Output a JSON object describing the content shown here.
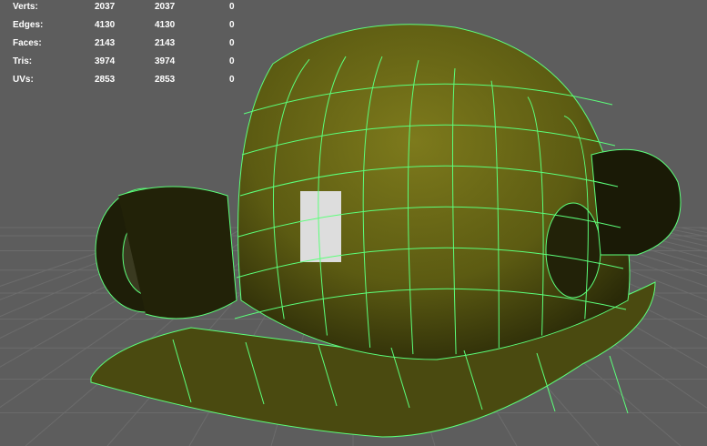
{
  "hud": {
    "rows": [
      {
        "label": "Verts:",
        "values": [
          "2037",
          "2037",
          "0"
        ]
      },
      {
        "label": "Edges:",
        "values": [
          "4130",
          "4130",
          "0"
        ]
      },
      {
        "label": "Faces:",
        "values": [
          "2143",
          "2143",
          "0"
        ]
      },
      {
        "label": "Tris:",
        "values": [
          "3974",
          "3974",
          "0"
        ]
      },
      {
        "label": "UVs:",
        "values": [
          "2853",
          "2853",
          "0"
        ]
      }
    ]
  },
  "colors": {
    "background": "#5d5d5d",
    "wireframe": "#5cff7a",
    "shell": "#6b6a14",
    "grid": "#6c6c6c"
  }
}
